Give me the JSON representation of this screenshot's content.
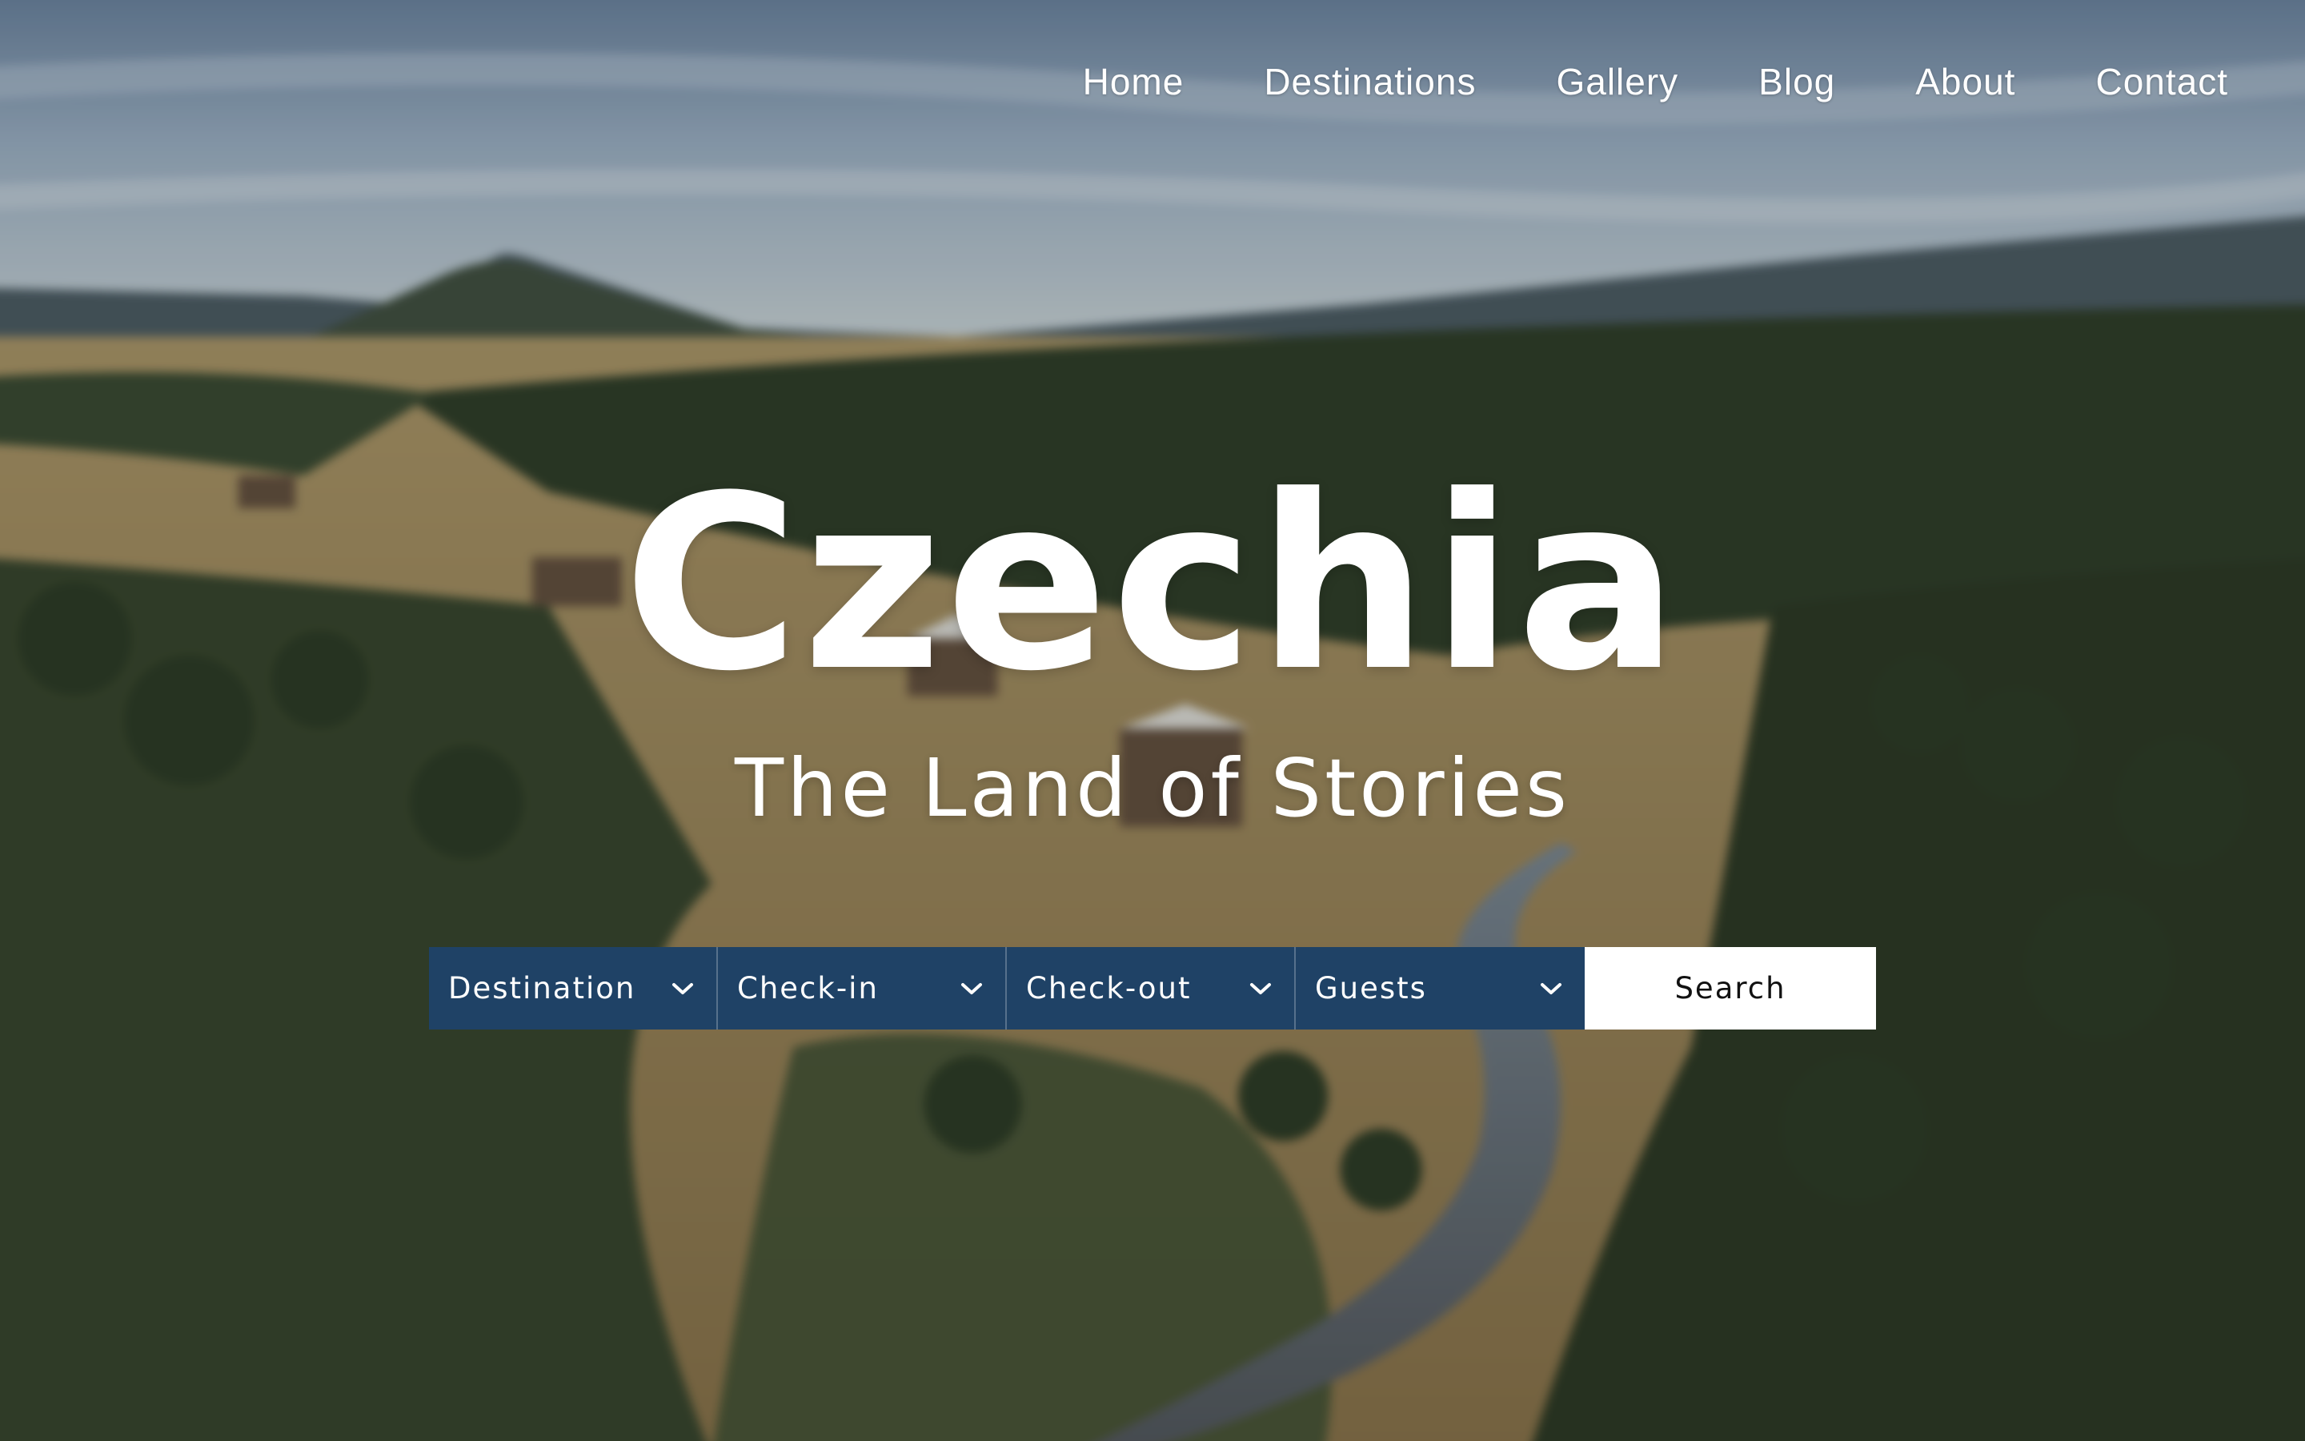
{
  "nav": {
    "items": [
      {
        "label": "Home"
      },
      {
        "label": "Destinations"
      },
      {
        "label": "Gallery"
      },
      {
        "label": "Blog"
      },
      {
        "label": "About"
      },
      {
        "label": "Contact"
      }
    ]
  },
  "hero": {
    "title": "Czechia",
    "subtitle": "The Land of Stories"
  },
  "search": {
    "fields": [
      {
        "label": "Destination",
        "icon": "chevron-down-icon"
      },
      {
        "label": "Check-in",
        "icon": "chevron-down-icon"
      },
      {
        "label": "Check-out",
        "icon": "chevron-down-icon"
      },
      {
        "label": "Guests",
        "icon": "chevron-down-icon"
      }
    ],
    "button_label": "Search"
  },
  "colors": {
    "search_field_bg": "#1f4266",
    "search_button_bg": "#ffffff",
    "nav_text": "#ffffff"
  }
}
